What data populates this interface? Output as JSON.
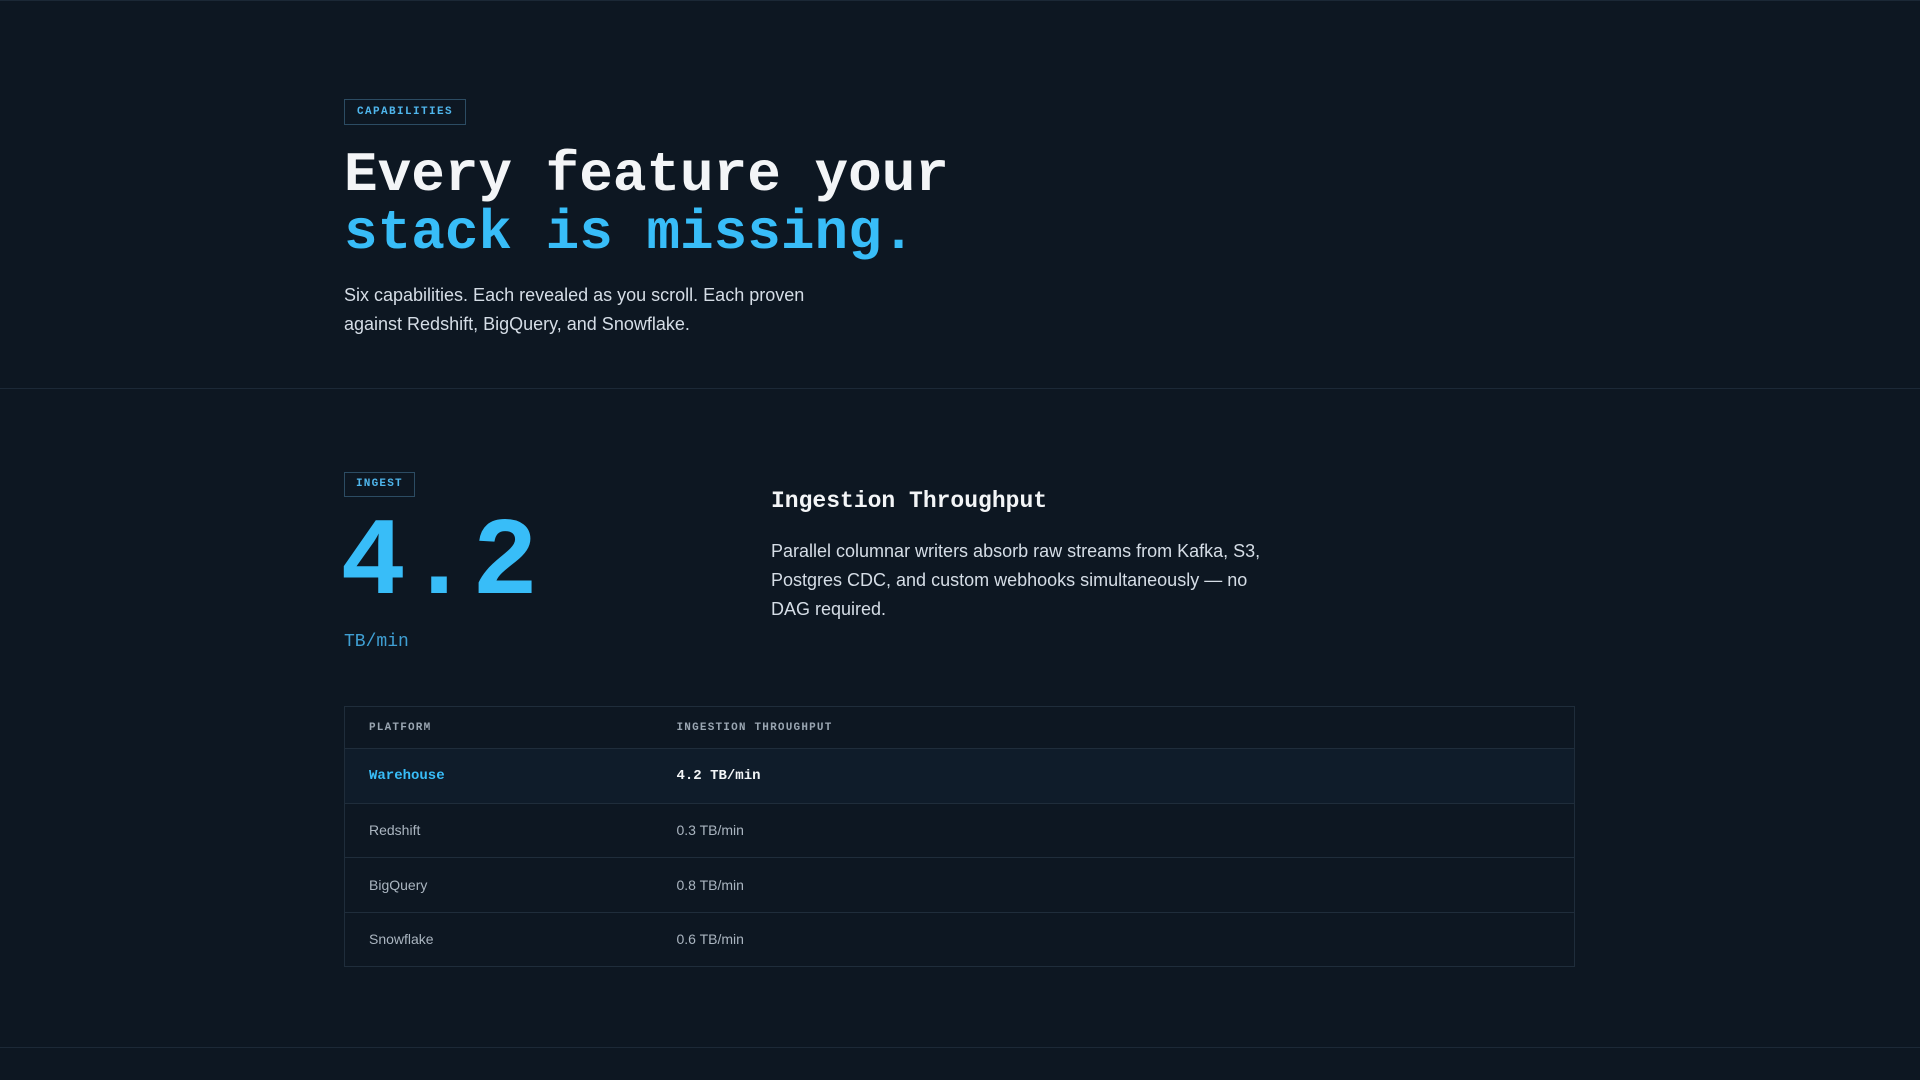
{
  "hero": {
    "eyebrow": "CAPABILITIES",
    "headline_line1": "Every feature your",
    "headline_line2": "stack is missing.",
    "subtitle": "Six capabilities. Each revealed as you scroll. Each proven against Redshift, BigQuery, and Snowflake."
  },
  "feature": {
    "tag": "INGEST",
    "metric_value": "4.2",
    "metric_unit": "TB/min",
    "title": "Ingestion Throughput",
    "description": "Parallel columnar writers absorb raw streams from Kafka, S3, Postgres CDC, and custom webhooks simultaneously — no DAG required."
  },
  "comparison_table": {
    "headers": [
      "PLATFORM",
      "INGESTION THROUGHPUT"
    ],
    "rows": [
      {
        "platform": "Warehouse",
        "value": "4.2 TB/min",
        "highlight": true
      },
      {
        "platform": "Redshift",
        "value": "0.3 TB/min",
        "highlight": false
      },
      {
        "platform": "BigQuery",
        "value": "0.8 TB/min",
        "highlight": false
      },
      {
        "platform": "Snowflake",
        "value": "0.6 TB/min",
        "highlight": false
      }
    ]
  },
  "colors": {
    "background": "#0d1722",
    "accent": "#38bdf8",
    "text_primary": "#f3f5f7",
    "text_muted": "#aab5c0",
    "border": "#1f2d3b"
  }
}
